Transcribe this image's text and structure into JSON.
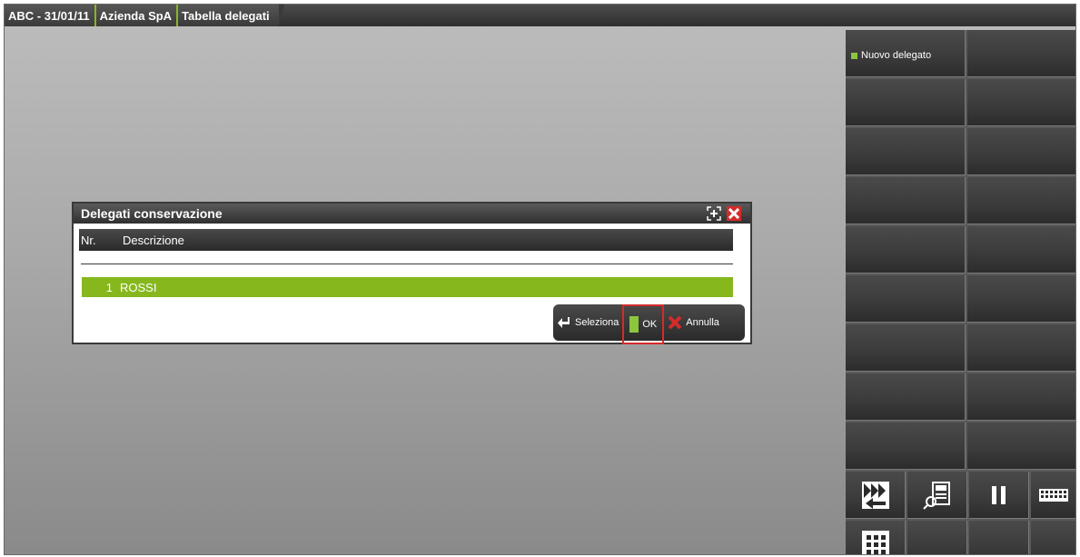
{
  "breadcrumbs": [
    "ABC - 31/01/11",
    "Azienda SpA",
    "Tabella delegati"
  ],
  "right_panel": {
    "new_delegate_label": "Nuovo delegato"
  },
  "dialog": {
    "title": "Delegati conservazione",
    "columns": [
      "Nr.",
      "Descrizione"
    ],
    "rows": [
      {
        "nr": "1",
        "descrizione": "ROSSI"
      }
    ],
    "actions": {
      "select_label": "Seleziona",
      "ok_label": "OK",
      "cancel_label": "Annulla"
    }
  },
  "colors": {
    "accent_green": "#86b81d",
    "highlight_red": "#d42b2b"
  },
  "icons": [
    "window-restore-icon",
    "close-icon",
    "enter-icon",
    "cancel-x-icon",
    "swap-arrows-icon",
    "document-search-icon",
    "pause-icon",
    "keyboard-icon",
    "numeric-keypad-icon"
  ]
}
